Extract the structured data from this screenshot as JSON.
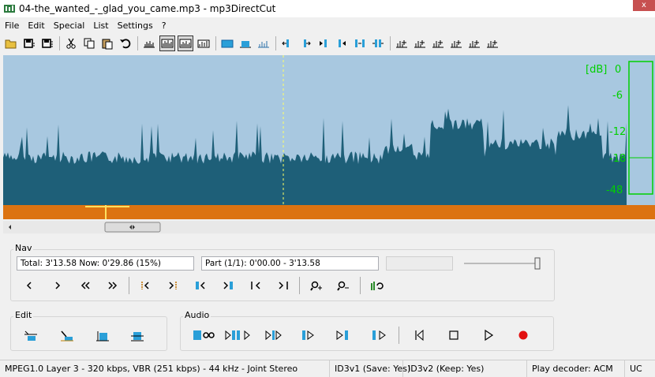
{
  "window": {
    "title": "04-the_wanted_-_glad_you_came.mp3 - mp3DirectCut",
    "close_label": "x"
  },
  "menu": [
    "File",
    "Edit",
    "Special",
    "List",
    "Settings",
    "?"
  ],
  "waveform": {
    "db_unit": "[dB]",
    "db_ticks": [
      "0",
      "-6",
      "-12",
      "-18",
      "-48"
    ],
    "colors": {
      "sky": "#a8c8e0",
      "wave": "#1e5f78",
      "cursor": "#ffff66",
      "meter": "#00d000",
      "orange": "#dc7311"
    }
  },
  "nav": {
    "title": "Nav",
    "total_now": "Total: 3'13.58   Now: 0'29.86  (15%)",
    "part": "Part (1/1): 0'00.00 - 3'13.58",
    "volume_level": 1.0
  },
  "edit": {
    "title": "Edit"
  },
  "audio": {
    "title": "Audio"
  },
  "status": {
    "format": "MPEG1.0 Layer 3 - 320 kbps, VBR (251 kbps) - 44 kHz - Joint Stereo",
    "id3v1": "ID3v1 (Save: Yes)",
    "id3v2": "ID3v2 (Keep: Yes)",
    "decoder": "Play decoder: ACM",
    "uc": "UC"
  }
}
